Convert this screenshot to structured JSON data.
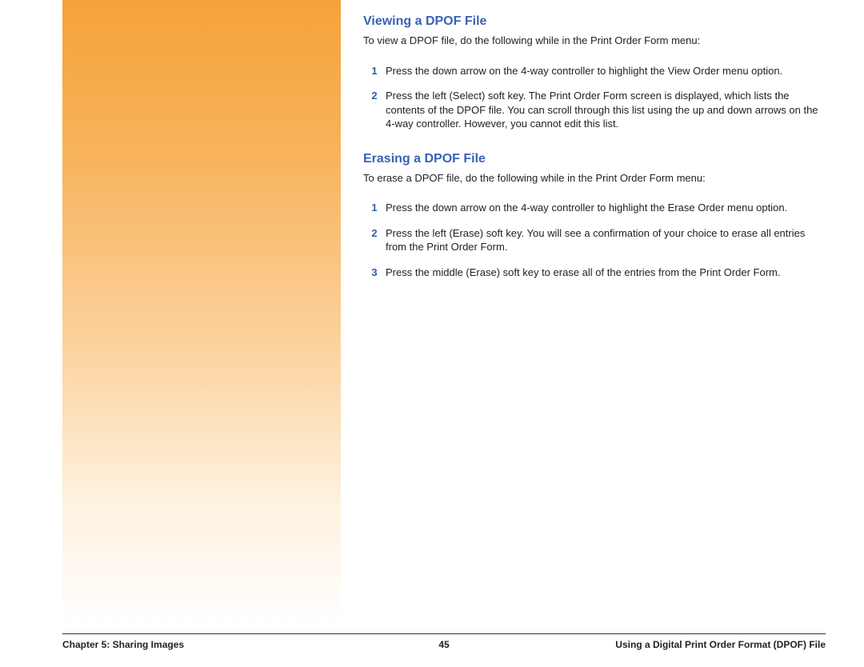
{
  "section1": {
    "heading": "Viewing a DPOF File",
    "intro": "To view a DPOF file, do the following while in the Print Order Form menu:",
    "steps": [
      "Press the down arrow on the 4-way controller to highlight the View Order menu option.",
      "Press the left (Select) soft key. The Print Order Form screen is displayed, which lists the contents of the DPOF file. You can scroll through this list using the up and down arrows on the 4-way controller. However, you cannot edit this list."
    ]
  },
  "section2": {
    "heading": "Erasing a DPOF File",
    "intro": "To erase a DPOF file, do the following while in the Print Order Form menu:",
    "steps": [
      "Press the down arrow on the 4-way controller to highlight the Erase Order menu option.",
      "Press the left (Erase) soft key. You will see a confirmation of your choice to erase all entries from the Print Order Form.",
      "Press the middle (Erase) soft key to erase all of the entries from the Print Order Form."
    ]
  },
  "footer": {
    "left": "Chapter 5: Sharing Images",
    "center": "45",
    "right": "Using a Digital Print Order Format (DPOF) File"
  }
}
